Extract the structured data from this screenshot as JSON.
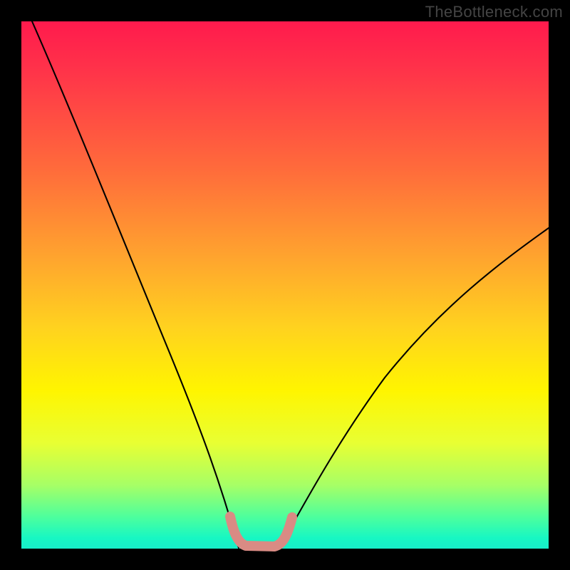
{
  "watermark": "TheBottleneck.com",
  "chart_data": {
    "type": "line",
    "title": "",
    "xlabel": "",
    "ylabel": "",
    "xlim": [
      0,
      1
    ],
    "ylim": [
      0,
      1
    ],
    "gradient_colors_top_to_bottom": [
      "#ff1a4d",
      "#ff3549",
      "#ff6b3b",
      "#ffa52e",
      "#ffd21f",
      "#fff500",
      "#e8ff33",
      "#a6ff66",
      "#4dff9d",
      "#17f7c3"
    ],
    "series": [
      {
        "name": "left-curve",
        "stroke": "#000000",
        "x": [
          0.02,
          0.06,
          0.11,
          0.16,
          0.21,
          0.26,
          0.3,
          0.33,
          0.36,
          0.39,
          0.41
        ],
        "y": [
          1.0,
          0.88,
          0.74,
          0.605,
          0.47,
          0.34,
          0.23,
          0.145,
          0.075,
          0.025,
          0.0
        ]
      },
      {
        "name": "right-curve",
        "stroke": "#000000",
        "x": [
          0.49,
          0.52,
          0.56,
          0.61,
          0.68,
          0.76,
          0.84,
          0.92,
          1.0
        ],
        "y": [
          0.0,
          0.05,
          0.12,
          0.2,
          0.3,
          0.395,
          0.475,
          0.545,
          0.61
        ]
      },
      {
        "name": "bottom-accent",
        "stroke": "#d98b84",
        "x": [
          0.395,
          0.405,
          0.42,
          0.455,
          0.49,
          0.505,
          0.515
        ],
        "y": [
          0.06,
          0.025,
          0.005,
          0.0,
          0.005,
          0.025,
          0.06
        ]
      }
    ],
    "legend": null
  }
}
